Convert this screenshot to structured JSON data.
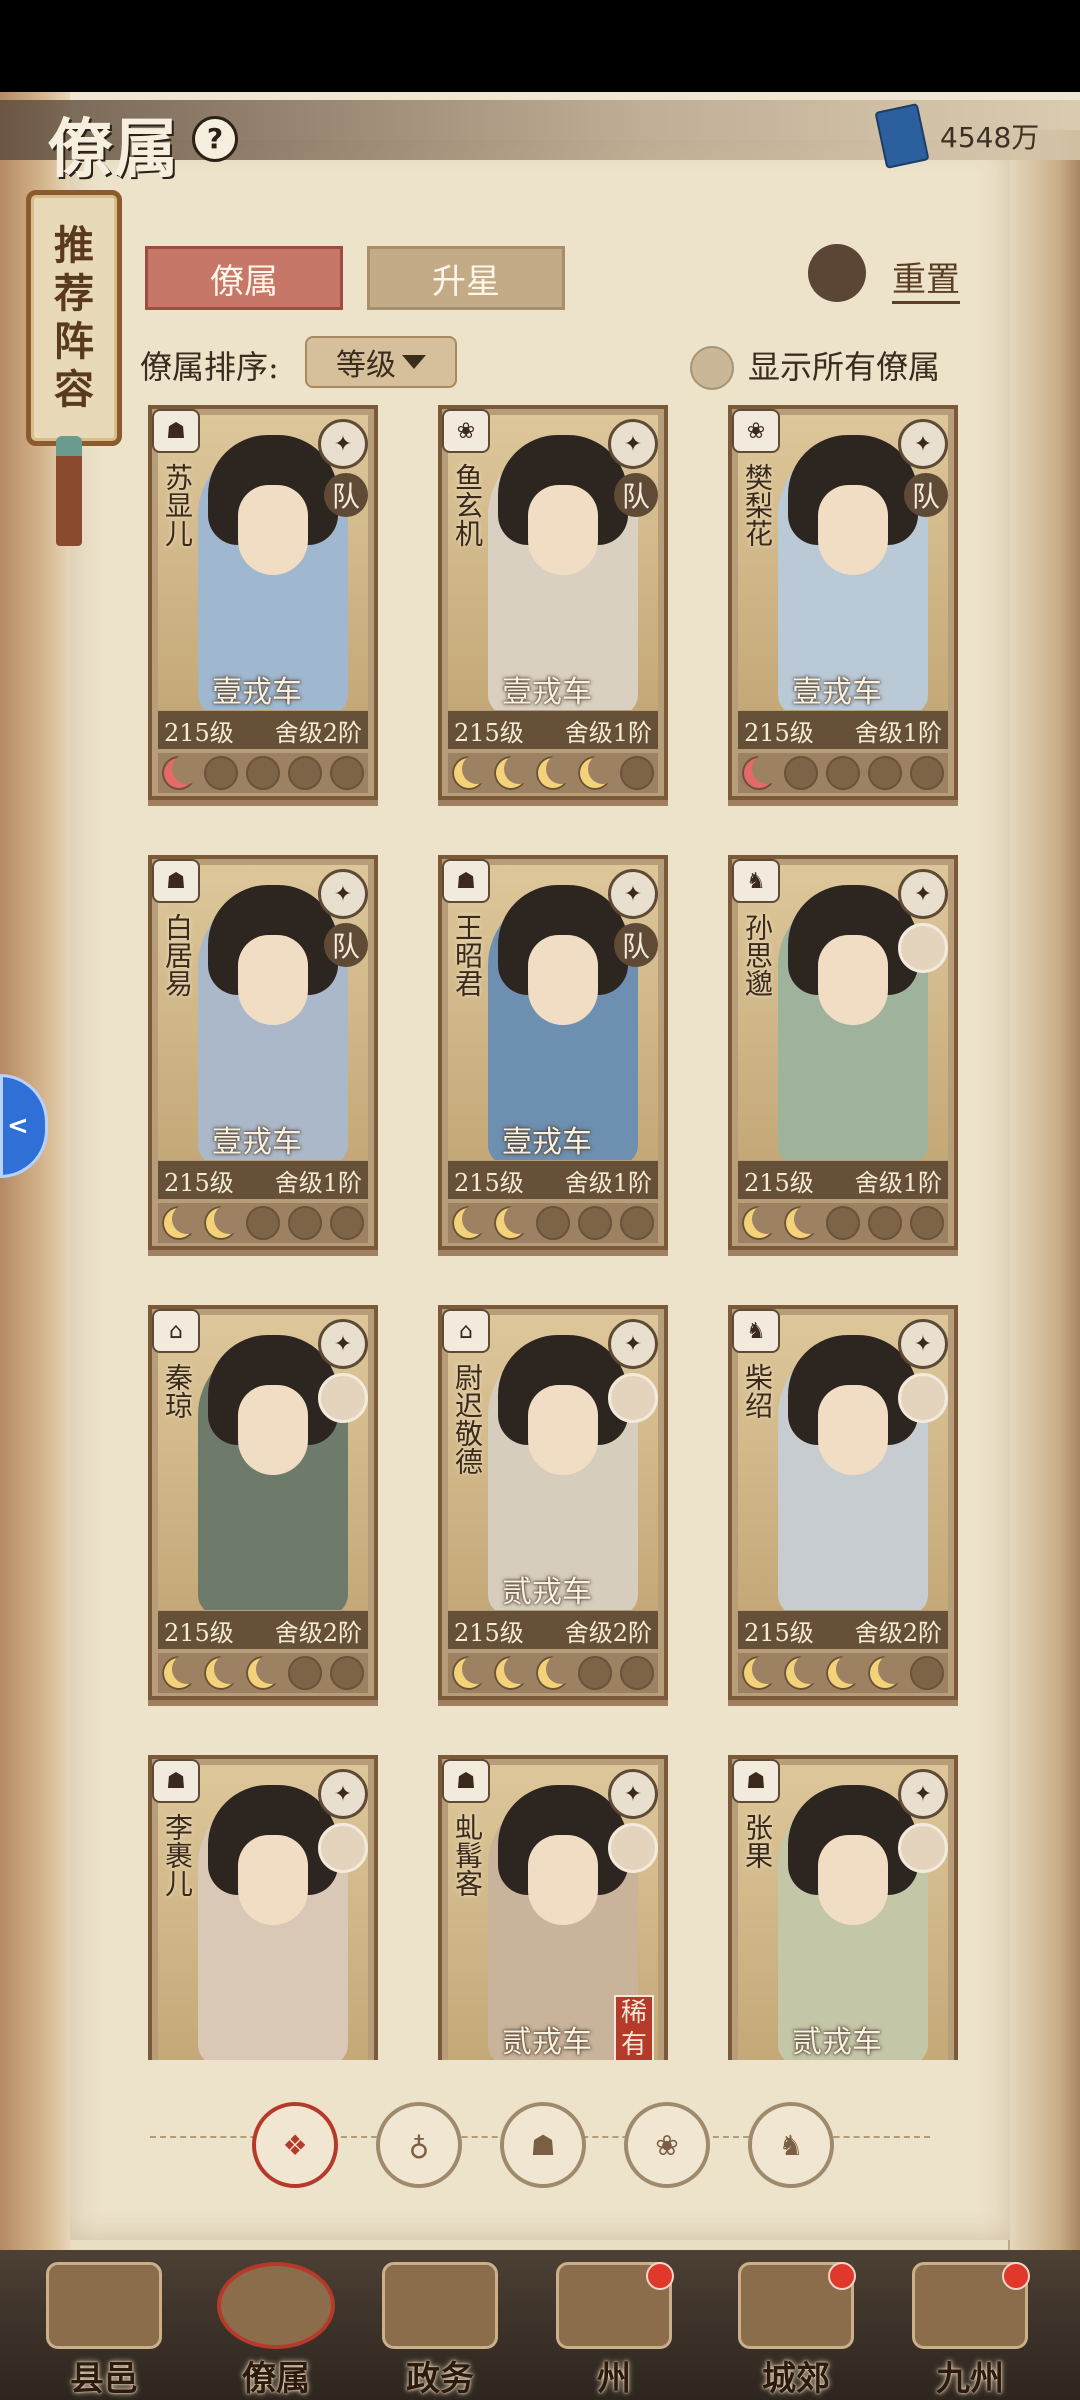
{
  "header": {
    "title": "僚属",
    "help_icon": "?",
    "currency_value": "4548万"
  },
  "scroll_banner": {
    "text": "推荐阵容"
  },
  "tabs": [
    {
      "label": "僚属",
      "active": true
    },
    {
      "label": "升星",
      "active": false
    }
  ],
  "reset": {
    "label": "重置"
  },
  "sort": {
    "label": "僚属排序:",
    "value": "等级"
  },
  "show_all": {
    "label": "显示所有僚属",
    "checked": false
  },
  "side_button": {
    "label": "<"
  },
  "cards": [
    {
      "name": "苏显儿",
      "vehicle": "壹戎车",
      "level": "215级",
      "rank": "舍级2阶",
      "team": "队",
      "moons": [
        "pink",
        "empty",
        "empty",
        "empty",
        "empty"
      ],
      "color": "#9fb7cf"
    },
    {
      "name": "鱼玄机",
      "vehicle": "壹戎车",
      "level": "215级",
      "rank": "舍级1阶",
      "team": "队",
      "moons": [
        "gold",
        "gold",
        "gold",
        "gold",
        "empty"
      ],
      "color": "#d9d0c2"
    },
    {
      "name": "樊梨花",
      "vehicle": "壹戎车",
      "level": "215级",
      "rank": "舍级1阶",
      "team": "队",
      "moons": [
        "pink",
        "empty",
        "empty",
        "empty",
        "empty"
      ],
      "color": "#b9c9d6"
    },
    {
      "name": "白居易",
      "vehicle": "壹戎车",
      "level": "215级",
      "rank": "舍级1阶",
      "team": "队",
      "moons": [
        "gold",
        "gold",
        "empty",
        "empty",
        "empty"
      ],
      "color": "#aab8c9"
    },
    {
      "name": "王昭君",
      "vehicle": "壹戎车",
      "level": "215级",
      "rank": "舍级1阶",
      "team": "队",
      "moons": [
        "gold",
        "gold",
        "empty",
        "empty",
        "empty"
      ],
      "color": "#6d8fb0"
    },
    {
      "name": "孙思邈",
      "vehicle": "",
      "level": "215级",
      "rank": "舍级1阶",
      "team": "",
      "moons": [
        "gold",
        "gold",
        "empty",
        "empty",
        "empty"
      ],
      "color": "#9fb39c"
    },
    {
      "name": "秦琼",
      "vehicle": "",
      "level": "215级",
      "rank": "舍级2阶",
      "team": "",
      "moons": [
        "gold",
        "gold",
        "gold",
        "empty",
        "empty"
      ],
      "color": "#6f7b6a"
    },
    {
      "name": "尉迟敬德",
      "vehicle": "贰戎车",
      "level": "215级",
      "rank": "舍级2阶",
      "team": "",
      "moons": [
        "gold",
        "gold",
        "gold",
        "empty",
        "empty"
      ],
      "color": "#d6cdbd"
    },
    {
      "name": "柴绍",
      "vehicle": "",
      "level": "215级",
      "rank": "舍级2阶",
      "team": "",
      "moons": [
        "gold",
        "gold",
        "gold",
        "gold",
        "empty"
      ],
      "color": "#c7ccd0"
    },
    {
      "name": "李裹儿",
      "vehicle": "",
      "level": "",
      "rank": "",
      "team": "",
      "moons": [],
      "color": "#d9c8b5"
    },
    {
      "name": "虬髯客",
      "vehicle": "贰戎车",
      "level": "",
      "rank": "",
      "team": "",
      "rarity": "稀有",
      "moons": [],
      "color": "#c9b49b"
    },
    {
      "name": "张果",
      "vehicle": "贰戎车",
      "level": "",
      "rank": "",
      "team": "",
      "moons": [],
      "color": "#c4c6a8"
    }
  ],
  "filters": [
    {
      "icon": "diamond-filter-icon",
      "active": true
    },
    {
      "icon": "bell-filter-icon"
    },
    {
      "icon": "cat-filter-icon"
    },
    {
      "icon": "fan-filter-icon"
    },
    {
      "icon": "horse-filter-icon"
    }
  ],
  "nav": [
    {
      "label": "县邑",
      "dot": false
    },
    {
      "label": "僚属",
      "dot": false,
      "active": true
    },
    {
      "label": "政务",
      "dot": false
    },
    {
      "label": "州",
      "dot": true
    },
    {
      "label": "城郊",
      "dot": true
    },
    {
      "label": "九州",
      "dot": true
    }
  ]
}
